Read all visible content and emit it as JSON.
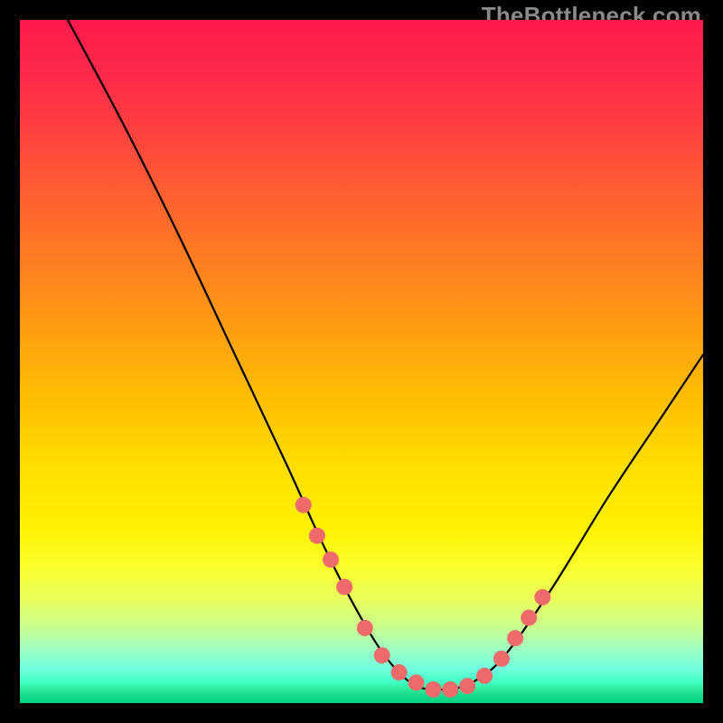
{
  "watermark": "TheBottleneck.com",
  "chart_data": {
    "type": "line",
    "title": "",
    "xlabel": "",
    "ylabel": "",
    "xlim": [
      0,
      100
    ],
    "ylim": [
      0,
      100
    ],
    "grid": false,
    "legend": false,
    "series": [
      {
        "name": "curve",
        "color": "#000000",
        "x": [
          7,
          15,
          23,
          31,
          39,
          44,
          48,
          52,
          55,
          58,
          61,
          64,
          67,
          71,
          78,
          86,
          94,
          100
        ],
        "y": [
          100,
          85,
          69,
          52,
          35,
          24,
          16,
          9,
          5,
          2.5,
          2,
          2.2,
          3.5,
          7,
          17,
          30,
          42,
          51
        ]
      }
    ],
    "markers": {
      "name": "highlight-points",
      "color": "#ef6b6b",
      "radius": 9,
      "x": [
        41.5,
        43.5,
        45.5,
        47.5,
        50.5,
        53,
        55.5,
        58,
        60.5,
        63,
        65.5,
        68,
        70.5,
        72.5,
        74.5,
        76.5
      ],
      "y": [
        29,
        24.5,
        21,
        17,
        11,
        7,
        4.5,
        3,
        2,
        2,
        2.5,
        4,
        6.5,
        9.5,
        12.5,
        15.5
      ]
    }
  }
}
